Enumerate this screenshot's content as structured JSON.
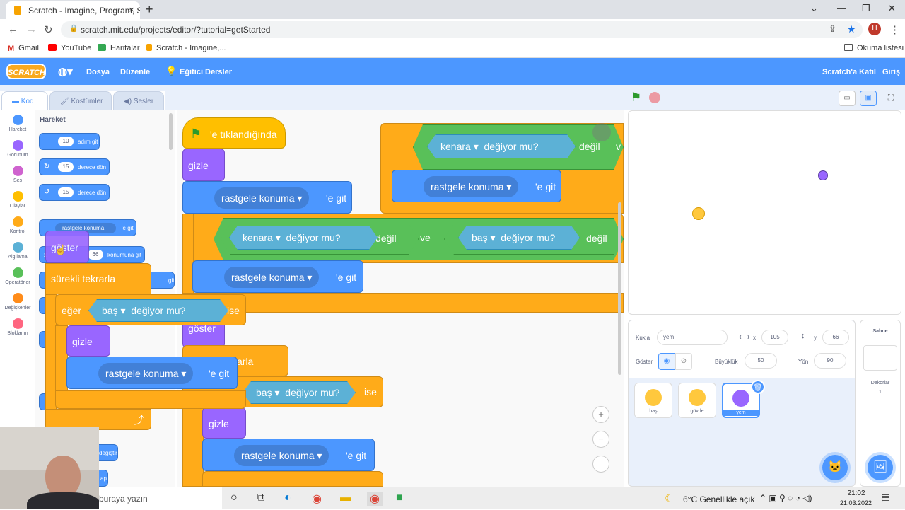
{
  "browser": {
    "tab_title": "Scratch - Imagine, Program, Share",
    "tab_close": "×",
    "new_tab": "+",
    "url": "scratch.mit.edu/projects/editor/?tutorial=getStarted",
    "bookmarks": [
      "Gmail",
      "YouTube",
      "Haritalar",
      "Scratch - Imagine,..."
    ],
    "reading_list": "Okuma listesi",
    "profile_initial": "H"
  },
  "menu": {
    "logo": "SCRATCH",
    "file": "Dosya",
    "edit": "Düzenle",
    "tutorials": "Eğitici Dersler",
    "join": "Scratch'a Katıl",
    "signin": "Giriş"
  },
  "editor_tabs": {
    "code": "Kod",
    "costumes": "Kostümler",
    "sounds": "Sesler"
  },
  "categories": [
    {
      "label": "Hareket",
      "color": "#4c97ff"
    },
    {
      "label": "Görünüm",
      "color": "#9966ff"
    },
    {
      "label": "Ses",
      "color": "#cf63cf"
    },
    {
      "label": "Olaylar",
      "color": "#ffbf00"
    },
    {
      "label": "Kontrol",
      "color": "#ffab19"
    },
    {
      "label": "Algılama",
      "color": "#5cb1d6"
    },
    {
      "label": "Operatörler",
      "color": "#59c059"
    },
    {
      "label": "Değişkenler",
      "color": "#ff8c1a"
    },
    {
      "label": "Bloklarım",
      "color": "#ff6680"
    }
  ],
  "palette": {
    "heading": "Hareket",
    "move_steps": "10",
    "move_label": "adım git",
    "turn_right_val": "15",
    "turn_right_label": "derece dön",
    "turn_left_val": "15",
    "turn_left_label": "derece dön",
    "goto_label": "rastgele konuma",
    "goto_suffix": "'e git",
    "pos_val": "66",
    "pos_label": "konumuna git",
    "change_label": "değiştir",
    "ap_label": "ap",
    "git_label": "git",
    "x_label": "x"
  },
  "script": {
    "hat": "'e tıklandığında",
    "hide1": "gizle",
    "goto_random": "rastgele konuma",
    "goto_suffix": "'e git",
    "touching_edge": "kenara",
    "touching_q": "değiyor mu?",
    "not": "değil",
    "and": "ve",
    "head": "baş",
    "v_cut": "v",
    "show": "göster",
    "forever_cut": "arla",
    "if_suffix": "ise"
  },
  "dragged": {
    "show": "göster",
    "forever": "sürekli tekrarla",
    "if": "eğer",
    "head": "baş",
    "touching_q": "değiyor mu?",
    "then": "ise",
    "hide": "gizle",
    "goto_random": "rastgele konuma",
    "goto_suffix": "'e git"
  },
  "zoom": {
    "in": "+",
    "out": "−",
    "reset": "="
  },
  "sprite_info": {
    "sprite_label": "Kukla",
    "sprite_name": "yem",
    "x_label": "x",
    "x_value": "105",
    "y_label": "y",
    "y_value": "66",
    "show_label": "Göster",
    "size_label": "Büyüklük",
    "size_value": "50",
    "direction_label": "Yön",
    "direction_value": "90"
  },
  "sprites": [
    {
      "name": "baş",
      "color": "#ffc83d"
    },
    {
      "name": "gövde",
      "color": "#ffc83d"
    },
    {
      "name": "yem",
      "color": "#9966ff"
    }
  ],
  "stage_panel": {
    "title": "Sahne",
    "backdrops_label": "Dekorlar",
    "backdrops_count": "1"
  },
  "taskbar": {
    "search_placeholder": "buraya yazın",
    "weather": "6°C  Genellikle açık",
    "time": "21:02",
    "date": "21.03.2022"
  }
}
